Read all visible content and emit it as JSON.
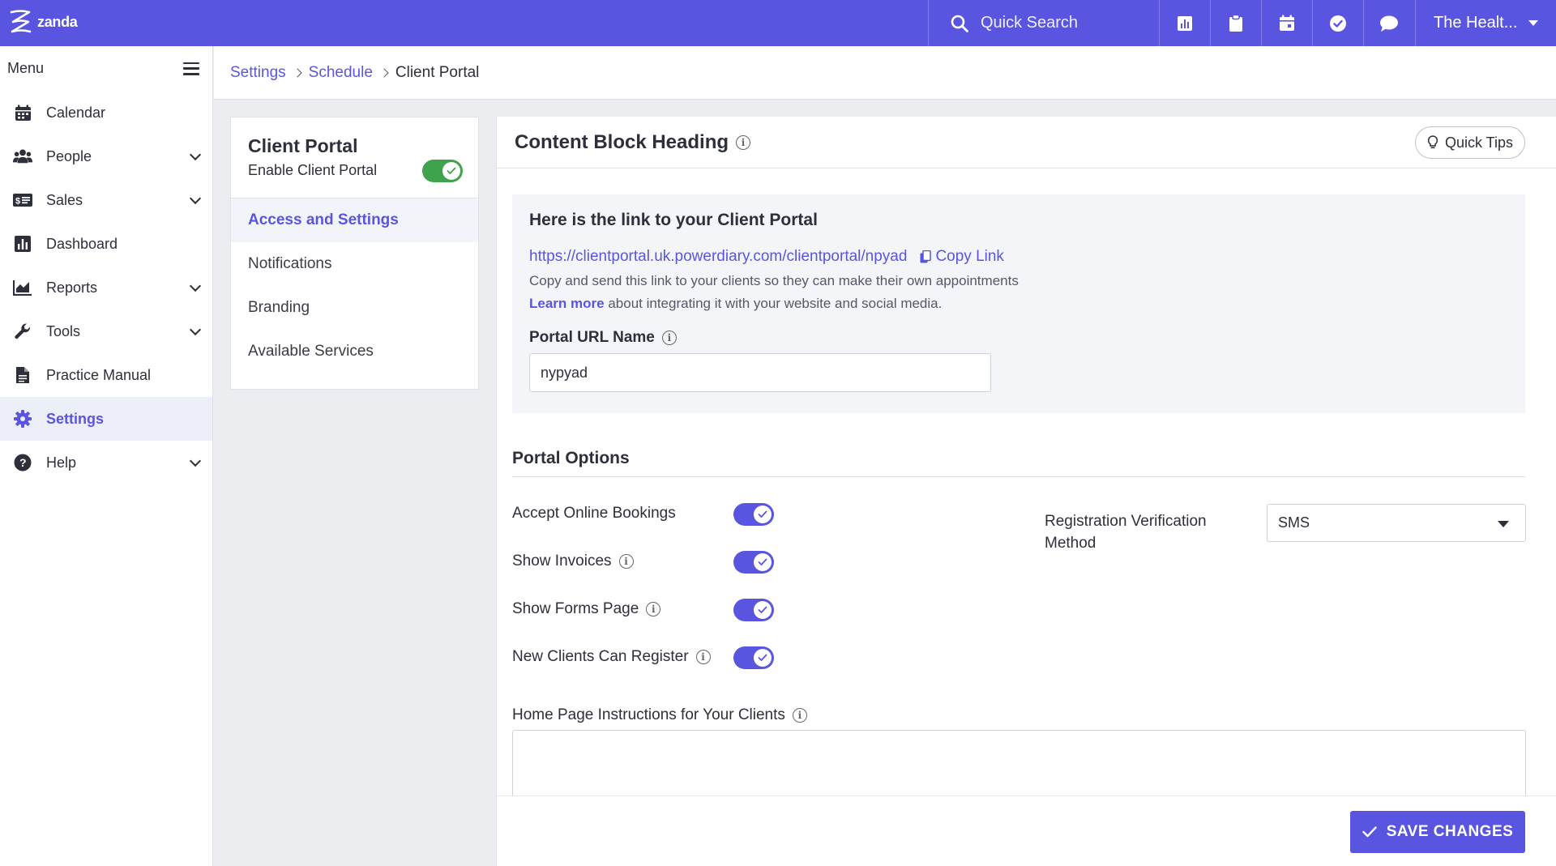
{
  "app": {
    "brand": "zanda",
    "search_label": "Quick Search",
    "account_label": "The Healt...",
    "colors": {
      "primary": "#5a55e0",
      "toggle_on_green": "#3fa34d",
      "toggle_on_purple": "#5a55e0"
    }
  },
  "sidebar": {
    "menu_label": "Menu",
    "items": [
      {
        "label": "Calendar",
        "icon": "calendar-icon",
        "expandable": false
      },
      {
        "label": "People",
        "icon": "people-icon",
        "expandable": true
      },
      {
        "label": "Sales",
        "icon": "sales-icon",
        "expandable": true
      },
      {
        "label": "Dashboard",
        "icon": "dashboard-icon",
        "expandable": false
      },
      {
        "label": "Reports",
        "icon": "reports-icon",
        "expandable": true
      },
      {
        "label": "Tools",
        "icon": "wrench-icon",
        "expandable": true
      },
      {
        "label": "Practice Manual",
        "icon": "document-icon",
        "expandable": false
      },
      {
        "label": "Settings",
        "icon": "gear-icon",
        "expandable": false,
        "active": true
      },
      {
        "label": "Help",
        "icon": "help-icon",
        "expandable": true
      }
    ]
  },
  "breadcrumb": {
    "items": [
      "Settings",
      "Schedule",
      "Client Portal"
    ]
  },
  "subpanel": {
    "title": "Client Portal",
    "enable_label": "Enable Client Portal",
    "enabled": true,
    "items": [
      "Access and Settings",
      "Notifications",
      "Branding",
      "Available Services"
    ],
    "active_index": 0
  },
  "main": {
    "title": "Content Block Heading",
    "quick_tips": "Quick Tips",
    "link_section": {
      "heading": "Here is the link to your Client Portal",
      "url": "https://clientportal.uk.powerdiary.com/clientportal/npyad",
      "copy_label": "Copy Link",
      "help_text": "Copy and send this link to your clients so they can make their own appointments",
      "learn_more": "Learn more",
      "learn_more_rest": "about integrating it with your website and social media.",
      "url_name_label": "Portal URL Name",
      "url_name_value": "nypyad"
    },
    "options": {
      "title": "Portal Options",
      "toggles": [
        {
          "label": "Accept Online Bookings",
          "info": false,
          "on": true
        },
        {
          "label": "Show Invoices",
          "info": true,
          "on": true
        },
        {
          "label": "Show Forms Page",
          "info": true,
          "on": true
        },
        {
          "label": "New Clients Can Register",
          "info": true,
          "on": true
        }
      ],
      "registration_label": "Registration Verification Method",
      "registration_value": "SMS"
    },
    "home_instructions_label": "Home Page Instructions for Your Clients",
    "home_instructions_value": "",
    "save_label": "SAVE CHANGES"
  }
}
